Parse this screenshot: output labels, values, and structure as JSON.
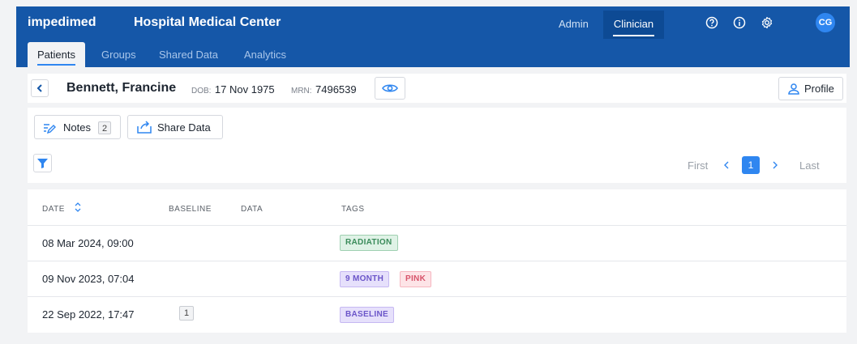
{
  "header": {
    "brand": "impedimed",
    "org": "Hospital Medical Center",
    "roles": {
      "admin": "Admin",
      "clinician": "Clinician"
    },
    "icons": [
      "help-icon",
      "info-icon",
      "settings-icon"
    ],
    "avatar": "CG"
  },
  "nav": {
    "tabs": [
      {
        "label": "Patients",
        "active": true
      },
      {
        "label": "Groups"
      },
      {
        "label": "Shared Data"
      },
      {
        "label": "Analytics"
      }
    ]
  },
  "patient": {
    "name": "Bennett, Francine",
    "dob_label": "DOB:",
    "dob": "17 Nov 1975",
    "mrn_label": "MRN:",
    "mrn": "7496539",
    "profile_label": "Profile"
  },
  "toolbar": {
    "notes_label": "Notes",
    "notes_count": "2",
    "share_label": "Share Data"
  },
  "pagination": {
    "first": "First",
    "current": "1",
    "last": "Last"
  },
  "table": {
    "headers": {
      "date": "DATE",
      "baseline": "BASELINE",
      "data": "DATA",
      "tags": "TAGS"
    },
    "rows": [
      {
        "date": "08 Mar 2024, 09:00",
        "tags": [
          "RADIATION"
        ]
      },
      {
        "date": "09 Nov 2023, 07:04",
        "tags": [
          "9 MONTH",
          "PINK"
        ]
      },
      {
        "date": "22 Sep 2022, 17:47",
        "baseline_count": "1",
        "tags": [
          "BASELINE"
        ]
      }
    ]
  },
  "colors": {
    "header_bg": "#1557a8",
    "accent": "#2f86f0",
    "tag_green": "#3a8b5a",
    "tag_purple": "#6b55c9",
    "tag_pink": "#d7536a"
  }
}
